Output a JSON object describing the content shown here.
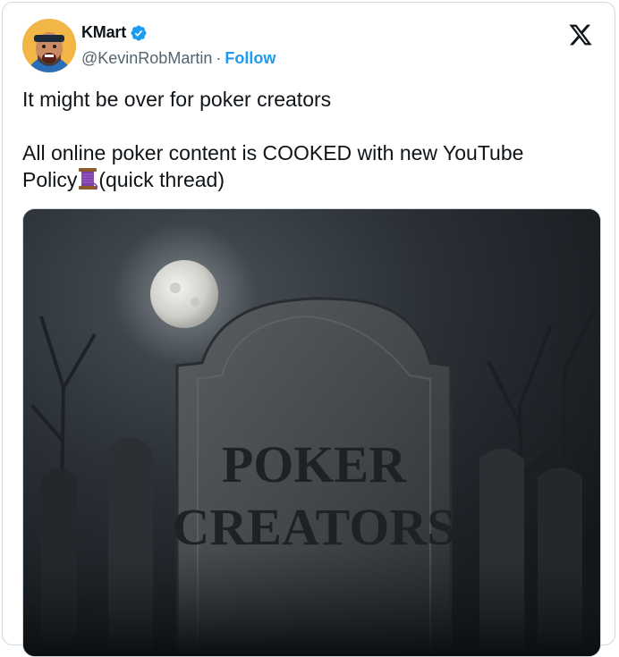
{
  "author": {
    "display_name": "KMart",
    "handle": "@KevinRobMartin",
    "separator": "·",
    "follow_label": "Follow",
    "verified": true
  },
  "tweet": {
    "line1": "It might be over for poker creators",
    "line2_part1": "All online poker content is COOKED with new YouTube",
    "line3_part1": "Policy",
    "line3_emoji": "thread-spool-emoji",
    "line3_part2": "(quick thread)"
  },
  "media": {
    "tombstone_line1": "POKER",
    "tombstone_line2": "CREATORS"
  },
  "icons": {
    "x_logo": "x-logo-icon",
    "verified": "verified-badge-icon"
  },
  "colors": {
    "link": "#1d9bf0",
    "text": "#0f1419",
    "muted": "#536471",
    "border": "#cfd9de"
  }
}
